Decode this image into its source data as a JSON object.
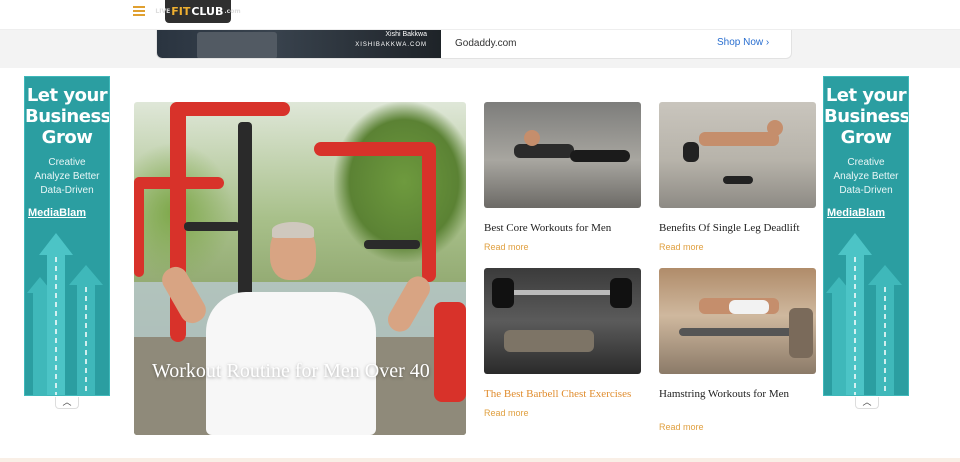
{
  "header": {
    "logo_prefix": "LIVE",
    "logo_fit": "FIT",
    "logo_club": "CLUB",
    "logo_suffix": ".com"
  },
  "top_ad": {
    "person_name": "Xishi Bakkwa",
    "person_site": "XISHIBAKKWA.COM",
    "domain": "Godaddy.com",
    "cta": "Shop Now ›"
  },
  "side_ad": {
    "headline": "Let your Business Grow",
    "line1": "Creative",
    "line2": "Analyze Better",
    "line3": "Data-Driven",
    "brand": "MediaBlam",
    "toggle": "︿"
  },
  "feature": {
    "title": "Workout Routine for Men Over 40"
  },
  "cards": [
    {
      "title": "Best Core Workouts for Men",
      "more": "Read more"
    },
    {
      "title": "Benefits Of Single Leg Deadlift",
      "more": "Read more"
    },
    {
      "title": "The Best Barbell Chest Exercises",
      "more": "Read more"
    },
    {
      "title": "Hamstring Workouts for Men",
      "more": "Read more"
    }
  ],
  "colors": {
    "accent": "#e08d2f",
    "banner_teal": "#2b9ea1",
    "link_blue": "#2a6fd0"
  }
}
